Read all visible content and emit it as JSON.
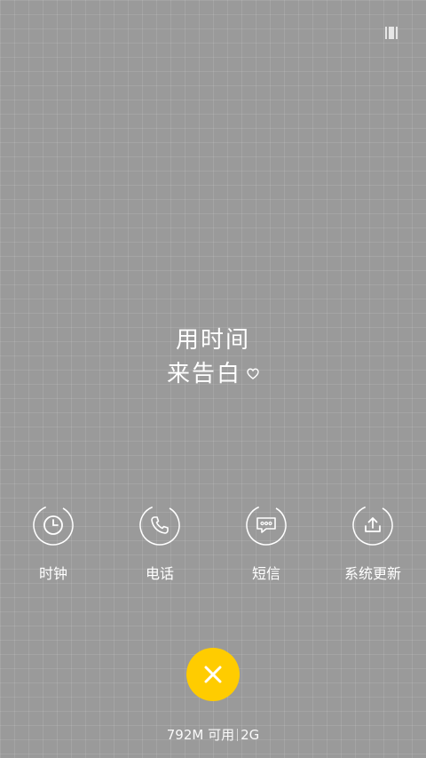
{
  "background": {
    "color": "#9a9a9a"
  },
  "center_text": {
    "line1": "用时间",
    "line2": "来告白"
  },
  "shortcuts": [
    {
      "label": "时钟",
      "icon": "clock-icon"
    },
    {
      "label": "电话",
      "icon": "phone-icon"
    },
    {
      "label": "短信",
      "icon": "message-icon"
    },
    {
      "label": "系统更新",
      "icon": "upload-icon"
    }
  ],
  "close_button": {
    "color": "#ffcc00",
    "icon": "close-icon"
  },
  "memory": {
    "available": "792M 可用",
    "network": "2G"
  },
  "top_right": {
    "icon": "barcode-icon"
  }
}
